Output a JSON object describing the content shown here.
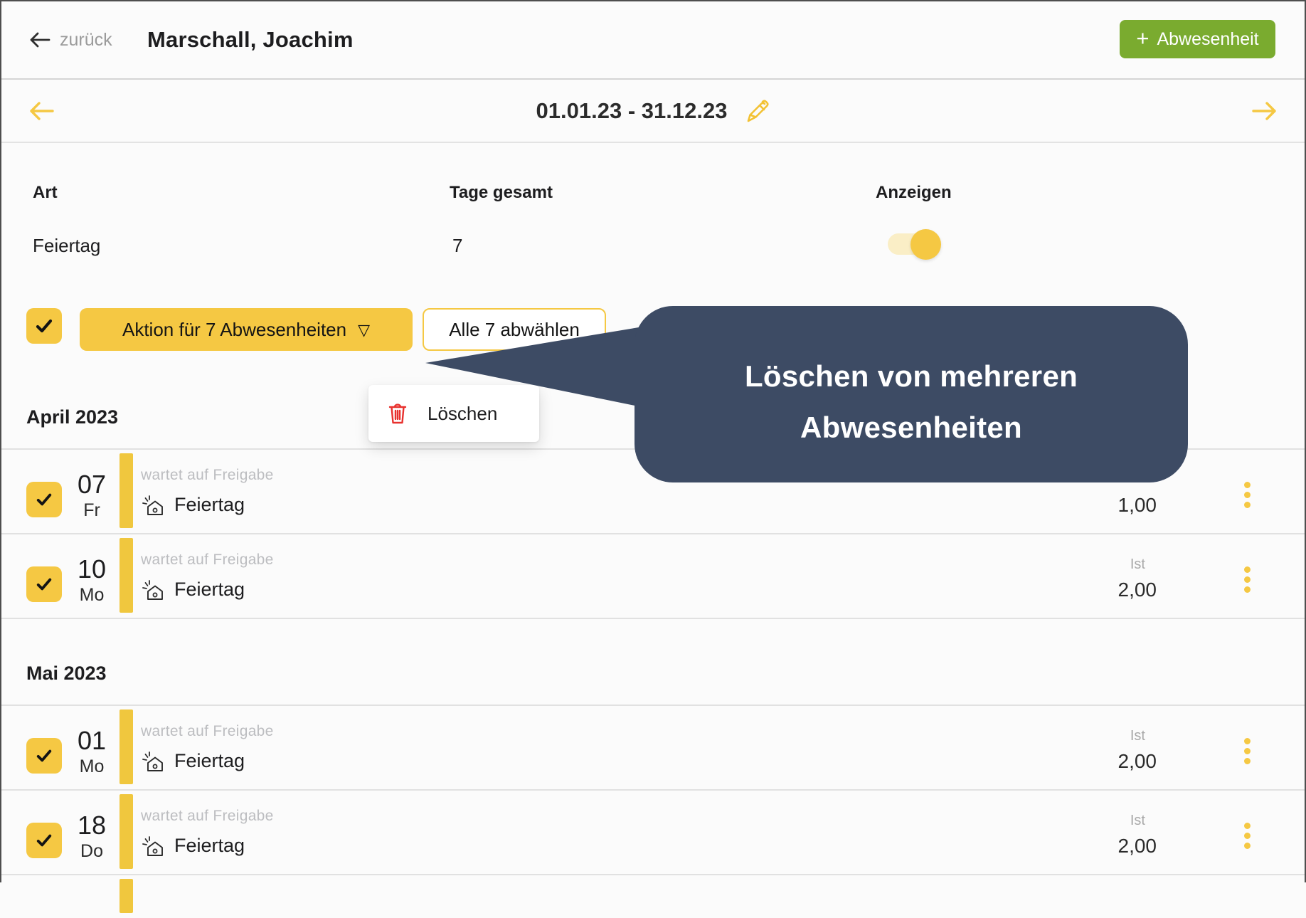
{
  "header": {
    "back_label": "zurück",
    "title": "Marschall, Joachim",
    "add_button_plus": "+",
    "add_button_label": "Abwesenheit"
  },
  "period_nav": {
    "range": "01.01.23 - 31.12.23"
  },
  "summary": {
    "col_art": "Art",
    "col_tage": "Tage gesamt",
    "col_anzeigen": "Anzeigen",
    "row": {
      "art": "Feiertag",
      "tage_gesamt": "7",
      "anzeigen_on": true
    }
  },
  "bulk_actions": {
    "select_all_checked": true,
    "action_button_label": "Aktion für 7 Abwesenheiten",
    "action_button_caret": "▽",
    "deselect_button_label": "Alle 7 abwählen",
    "menu": {
      "delete_label": "Löschen"
    }
  },
  "callout": {
    "line1": "Löschen von mehreren",
    "line2": "Abwesenheiten"
  },
  "sections": [
    {
      "month": "April 2023",
      "rows": [
        {
          "day": "07",
          "weekday": "Fr",
          "status": "wartet auf Freigabe",
          "type": "Feiertag",
          "checked": true,
          "ist_label": "",
          "value": "1,00"
        },
        {
          "day": "10",
          "weekday": "Mo",
          "status": "wartet auf Freigabe",
          "type": "Feiertag",
          "checked": true,
          "ist_label": "Ist",
          "value": "2,00"
        }
      ],
      "partial_next_row": false
    },
    {
      "month": "Mai 2023",
      "rows": [
        {
          "day": "01",
          "weekday": "Mo",
          "status": "wartet auf Freigabe",
          "type": "Feiertag",
          "checked": true,
          "ist_label": "Ist",
          "value": "2,00"
        },
        {
          "day": "18",
          "weekday": "Do",
          "status": "wartet auf Freigabe",
          "type": "Feiertag",
          "checked": true,
          "ist_label": "Ist",
          "value": "2,00"
        }
      ],
      "partial_next_row": true
    }
  ],
  "colors": {
    "accent_yellow": "#F5C843",
    "accent_yellow_bar": "#F0C73E",
    "toggle_track": "#FAEEC6",
    "green": "#7AAB2F",
    "callout_bg": "#3D4B64",
    "danger_red": "#E8312E",
    "status_gray": "#BCBDC0",
    "page_bg": "#FBFBFB"
  }
}
